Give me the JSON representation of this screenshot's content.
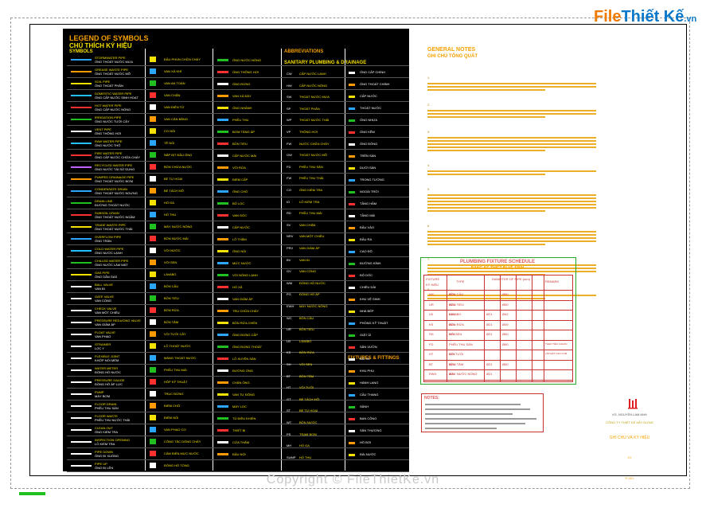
{
  "brand": {
    "left": "File",
    "right": "Thiết Kế",
    "domain": ".vn"
  },
  "legend": {
    "title": "LEGEND OF SYMBOLS",
    "subtitle": "CHÚ THÍCH KÝ HIỆU",
    "section_symbols": "SYMBOLS",
    "section_abbrev": "ABBREVIATIONS",
    "section_abbrev_sub": "SANITARY PLUMBING & DRAINAGE",
    "section_fixtures": "FIXTURES & FITTINGS"
  },
  "col1": [
    {
      "a": "STORMWATER PIPE",
      "b": "ỐNG THOÁT NƯỚC MƯA",
      "c": "#2aa6ff"
    },
    {
      "a": "GREASE WASTE PIPE",
      "b": "ỐNG THOÁT NƯỚC MỠ",
      "c": "#ff9a00"
    },
    {
      "a": "SOIL PIPE",
      "b": "ỐNG THOÁT PHÂN",
      "c": "#f5e100"
    },
    {
      "a": "DOMESTIC WATER PIPE",
      "b": "ỐNG CẤP NƯỚC SINH HOẠT",
      "c": "#22c0ff"
    },
    {
      "a": "HOT WATER PIPE",
      "b": "ỐNG CẤP NƯỚC NÓNG",
      "c": "#ff3030"
    },
    {
      "a": "IRRIGATION PIPE",
      "b": "ỐNG NƯỚC TƯỚI CÂY",
      "c": "#21c021"
    },
    {
      "a": "VENT PIPE",
      "b": "ỐNG THÔNG HƠI",
      "c": "#ffffff"
    },
    {
      "a": "RAW WATER PIPE",
      "b": "ỐNG NƯỚC THÔ",
      "c": "#22c0ff"
    },
    {
      "a": "FIRE WATER PIPE",
      "b": "ỐNG CẤP NƯỚC CHỮA CHÁY",
      "c": "#ff3030"
    },
    {
      "a": "RECYCLED WATER PIPE",
      "b": "ỐNG NƯỚC TÁI SỬ DỤNG",
      "c": "#c060ff"
    },
    {
      "a": "PUMPED DRAINAGE PIPE",
      "b": "ỐNG THOÁT NƯỚC BƠM",
      "c": "#ff9a00"
    },
    {
      "a": "CONDENSATE DRAIN",
      "b": "ỐNG THOÁT NƯỚC NGƯNG",
      "c": "#2aa6ff"
    },
    {
      "a": "DRAIN LINE",
      "b": "ĐƯỜNG THOÁT NƯỚC",
      "c": "#21c021"
    },
    {
      "a": "SUBSOIL DRAIN",
      "b": "ỐNG THOÁT NƯỚC NGẦM",
      "c": "#ff3030"
    },
    {
      "a": "TRADE WASTE PIPE",
      "b": "ỐNG THOÁT NƯỚC THẢI",
      "c": "#f5e100"
    },
    {
      "a": "OVERFLOW PIPE",
      "b": "ỐNG TRÀN",
      "c": "#2aa6ff"
    },
    {
      "a": "COLD WATER PIPE",
      "b": "ỐNG NƯỚC LẠNH",
      "c": "#22c0ff"
    },
    {
      "a": "CHILLED WATER PIPE",
      "b": "ỐNG NƯỚC LÀM MÁT",
      "c": "#21c021"
    },
    {
      "a": "GAS PIPE",
      "b": "ỐNG DẪN GAS",
      "c": "#f5e100"
    },
    {
      "a": "BALL VALVE",
      "b": "VAN BI",
      "c": "#ffffff"
    },
    {
      "a": "GATE VALVE",
      "b": "VAN CỔNG",
      "c": "#ffffff"
    },
    {
      "a": "CHECK VALVE",
      "b": "VAN MỘT CHIỀU",
      "c": "#ffffff"
    },
    {
      "a": "PRESSURE REDUCING VALVE",
      "b": "VAN GIẢM ÁP",
      "c": "#ffffff"
    },
    {
      "a": "FLOAT VALVE",
      "b": "VAN PHAO",
      "c": "#ffffff"
    },
    {
      "a": "STRAINER",
      "b": "LỌC Y",
      "c": "#ffffff"
    },
    {
      "a": "FLEXIBLE JOINT",
      "b": "KHỚP NỐI MỀM",
      "c": "#ffffff"
    },
    {
      "a": "WATER METER",
      "b": "ĐỒNG HỒ NƯỚC",
      "c": "#ffffff"
    },
    {
      "a": "PRESSURE GAUGE",
      "b": "ĐỒNG HỒ ÁP LỰC",
      "c": "#ffffff"
    },
    {
      "a": "PUMP",
      "b": "MÁY BƠM",
      "c": "#ffffff"
    },
    {
      "a": "FLOOR DRAIN",
      "b": "PHỄU THU SÀN",
      "c": "#ffffff"
    },
    {
      "a": "FLOOR WASTE",
      "b": "PHỄU THU NƯỚC THẢI",
      "c": "#ffffff"
    },
    {
      "a": "CLEAN OUT",
      "b": "ỐNG KIỂM TRA",
      "c": "#ffffff"
    },
    {
      "a": "INSPECTION OPENING",
      "b": "LỖ KIỂM TRA",
      "c": "#ffffff"
    },
    {
      "a": "PIPE DOWN",
      "b": "ỐNG ĐI XUỐNG",
      "c": "#ffffff"
    },
    {
      "a": "PIPE UP",
      "b": "ỐNG ĐI LÊN",
      "c": "#ffffff"
    }
  ],
  "col2": [
    "ĐẦU PHUN CHỮA CHÁY",
    "VAN XẢ KHÍ",
    "VAN AN TOÀN",
    "VAN CHẶN",
    "VAN ĐIỆN TỪ",
    "VAN CÂN BẰNG",
    "CO NỐI",
    "TÊ NỐI",
    "NẮP BỊT ĐẦU ỐNG",
    "BỒN CHỨA NƯỚC",
    "BỂ TỰ HOẠI",
    "BỂ TÁCH MỠ",
    "HỐ GA",
    "HỐ THU",
    "MÁY NƯỚC NÓNG",
    "BỒN NƯỚC MÁI",
    "VÒI NƯỚC",
    "VÒI SEN",
    "LAVABO",
    "BỒN CẦU",
    "BỒN TIỂU",
    "BỒN RỬA",
    "BỒN TẮM",
    "VÒI TƯỚI CÂY",
    "LỖ THOÁT NƯỚC",
    "MÁNG THOÁT NƯỚC",
    "PHỄU THU MÁI",
    "HỘP KỸ THUẬT",
    "TRỤC ĐỨNG",
    "ĐIỂM CHỜ",
    "ĐIỂM NỐI",
    "VAN PHAO CƠ",
    "CÔNG TẮC DÒNG CHẢY",
    "CẢM BIẾN MỰC NƯỚC",
    "ĐỒNG HỒ TỔNG"
  ],
  "col3": [
    "ỐNG NƯỚC NÓNG",
    "ỐNG THÔNG HƠI",
    "ỐNG ĐỨNG",
    "VAN XẢ ĐÁY",
    "ỐNG NHÁNH",
    "PHỄU THU",
    "BƠM TĂNG ÁP",
    "BỒN TIỂU",
    "CẤP NƯỚC MÁI",
    "VÒI RỬA",
    "ĐIỂM CẤP",
    "ỐNG CHỜ",
    "BỘ LỌC",
    "VAN GÓC",
    "CẤP NƯỚC",
    "LỖ THĂM",
    "ỐNG NỐI",
    "MỨC NƯỚC",
    "VÒI NÓNG LẠNH",
    "HỐ XẢ",
    "VAN GIẢM ÁP",
    "TRỤ CHỮA CHÁY",
    "BỒN RỬA CHÉN",
    "ỐNG ĐỨNG CẤP",
    "ỐNG ĐỨNG THOÁT",
    "LỖ XUYÊN SÀN",
    "ĐƯỜNG ỐNG",
    "CHÂN ỐNG",
    "VAN TỰ ĐỘNG",
    "MÁY LỌC",
    "TỦ ĐIỀU KHIỂN",
    "THIẾT BỊ",
    "CỬA THĂM",
    "ĐẦU NỐI"
  ],
  "col4": [
    {
      "k": "CW",
      "v": "CẤP NƯỚC LẠNH"
    },
    {
      "k": "HW",
      "v": "CẤP NƯỚC NÓNG"
    },
    {
      "k": "SW",
      "v": "THOÁT NƯỚC MƯA"
    },
    {
      "k": "SP",
      "v": "THOÁT PHÂN"
    },
    {
      "k": "WP",
      "v": "THOÁT NƯỚC THẢI"
    },
    {
      "k": "VP",
      "v": "THÔNG HƠI"
    },
    {
      "k": "FW",
      "v": "NƯỚC CHỮA CHÁY"
    },
    {
      "k": "GW",
      "v": "THOÁT NƯỚC MỠ"
    },
    {
      "k": "FD",
      "v": "PHỄU THU SÀN"
    },
    {
      "k": "FW",
      "v": "PHỄU THU THẢI"
    },
    {
      "k": "CO",
      "v": "ỐNG KIỂM TRA"
    },
    {
      "k": "IO",
      "v": "LỖ KIỂM TRA"
    },
    {
      "k": "RD",
      "v": "PHỄU THU MÁI"
    },
    {
      "k": "SV",
      "v": "VAN CHẶN"
    },
    {
      "k": "NRV",
      "v": "VAN MỘT CHIỀU"
    },
    {
      "k": "PRV",
      "v": "VAN GIẢM ÁP"
    },
    {
      "k": "BV",
      "v": "VAN BI"
    },
    {
      "k": "GV",
      "v": "VAN CỔNG"
    },
    {
      "k": "WM",
      "v": "ĐỒNG HỒ NƯỚC"
    },
    {
      "k": "PG",
      "v": "ĐỒNG HỒ ÁP"
    },
    {
      "k": "EWH",
      "v": "MÁY NƯỚC NÓNG"
    },
    {
      "k": "WC",
      "v": "BỒN CẦU"
    },
    {
      "k": "UR",
      "v": "BỒN TIỂU"
    },
    {
      "k": "LB",
      "v": "LAVABO"
    },
    {
      "k": "KS",
      "v": "BỒN RỬA"
    },
    {
      "k": "SH",
      "v": "VÒI SEN"
    },
    {
      "k": "BT",
      "v": "BỒN TẮM"
    },
    {
      "k": "HT",
      "v": "VÒI TƯỚI"
    },
    {
      "k": "GT",
      "v": "BỂ TÁCH MỠ"
    },
    {
      "k": "ST",
      "v": "BỂ TỰ HOẠI"
    },
    {
      "k": "WT",
      "v": "BỒN NƯỚC"
    },
    {
      "k": "PS",
      "v": "TRẠM BƠM"
    },
    {
      "k": "MH",
      "v": "HỐ GA"
    },
    {
      "k": "SUMP",
      "v": "HỐ THU"
    }
  ],
  "col5": [
    "ỐNG CẤP CHÍNH",
    "ỐNG THOÁT CHÍNH",
    "CẤP NƯỚC",
    "THOÁT NƯỚC",
    "ỐNG NHỰA",
    "ỐNG KẼM",
    "ỐNG ĐỒNG",
    "TRÊN SÀN",
    "DƯỚI SÀN",
    "TRONG TƯỜNG",
    "NGOÀI TRỜI",
    "TẦNG HẦM",
    "TẦNG MÁI",
    "ĐẦU VÀO",
    "ĐẦU RA",
    "CAO ĐỘ",
    "ĐƯỜNG KÍNH",
    "ĐỘ DỐC",
    "CHIỀU DÀI",
    "KHU VỆ SINH",
    "NHÀ BẾP",
    "PHÒNG KỸ THUẬT",
    "GIẶT ỦI",
    "SÂN VƯỜN",
    "BÃI XE",
    "KHU PHỤ",
    "HÀNH LANG",
    "CẦU THANG",
    "SẢNH",
    "BAN CÔNG",
    "SÂN THƯỢNG",
    "HỒ BƠI",
    "ĐÀI NƯỚC"
  ],
  "notes": {
    "title": "GENERAL NOTES",
    "subtitle": "GHI CHÚ TỔNG QUÁT",
    "items": [
      "1.",
      "2.",
      "3.",
      "4.",
      "5.",
      "6.",
      "7.",
      "8."
    ]
  },
  "schedule": {
    "title": "PLUMBING FIXTURE SCHEDULE",
    "subtitle": "BẢNG KÊ THIẾT BỊ VỆ SINH",
    "head_fixture": "FIXTURE",
    "head_fixture_vn": "KÝ HIỆU",
    "head_type": "TYPE",
    "head_dia": "DIAMETER OF PIPE (mm)",
    "head_remark": "REMARK",
    "rows": [
      {
        "code": "WC",
        "name": "BỒN CẦU",
        "v": [
          "Ø21",
          "",
          "Ø90",
          ""
        ],
        "r": ""
      },
      {
        "code": "UR",
        "name": "BỒN TIỂU",
        "v": [
          "Ø21",
          "",
          "Ø60",
          ""
        ],
        "r": ""
      },
      {
        "code": "LB",
        "name": "LAVABO",
        "v": [
          "Ø21",
          "Ø21",
          "Ø42",
          ""
        ],
        "r": ""
      },
      {
        "code": "KS",
        "name": "BỒN RỬA",
        "v": [
          "Ø21",
          "Ø21",
          "Ø49",
          ""
        ],
        "r": ""
      },
      {
        "code": "SH",
        "name": "VÒI SEN",
        "v": [
          "Ø21",
          "Ø21",
          "Ø60",
          ""
        ],
        "r": ""
      },
      {
        "code": "FD",
        "name": "PHỄU THU SÀN",
        "v": [
          "",
          "",
          "Ø60",
          ""
        ],
        "r": "THEO TIÊU CHUẨN"
      },
      {
        "code": "HT",
        "name": "VÒI TƯỚI",
        "v": [
          "Ø21",
          "",
          "",
          ""
        ],
        "r": "LẮP ĐẶT CAO 0.6M"
      },
      {
        "code": "BT",
        "name": "BỒN TẮM",
        "v": [
          "Ø21",
          "Ø21",
          "Ø60",
          ""
        ],
        "r": ""
      },
      {
        "code": "EWH",
        "name": "MÁY NƯỚC NÓNG",
        "v": [
          "Ø21",
          "Ø21",
          "",
          ""
        ],
        "r": ""
      }
    ]
  },
  "notes2": {
    "title": "NOTES:"
  },
  "title_block": {
    "designer": "KS. NGUYỄN LAM ANH",
    "company": "CÔNG TY THIẾT KẾ XÂY DỰNG",
    "drawing_title": "GHI CHÚ VÀ KÝ HIỆU",
    "sheet_no": "01",
    "rev": "P-001"
  },
  "watermark": "Copyright © FileThietKe.vn"
}
